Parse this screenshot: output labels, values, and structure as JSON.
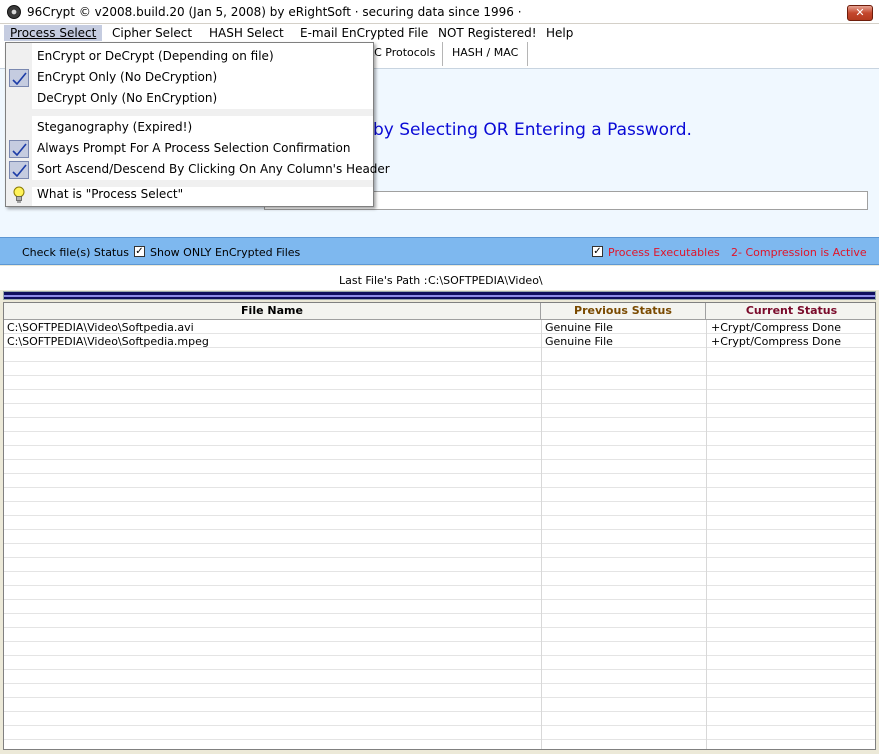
{
  "window": {
    "title": "96Crypt © v2008.build.20 (Jan 5, 2008) by eRightSoft ·   securing data since 1996   ·",
    "close_label": "✕"
  },
  "menu": {
    "process_select": "Process Select",
    "cipher_select": "Cipher Select",
    "hash_select": "HASH Select",
    "email_file": "E-mail EnCrypted File",
    "not_registered": "NOT Registered!",
    "help": "Help"
  },
  "tabs": {
    "crc": "RC Protocols",
    "hash_mac": "HASH / MAC"
  },
  "banner": {
    "text": "by Selecting OR Entering a Password."
  },
  "status_bar": {
    "check_status": "Check file(s) Status",
    "show_only_label": "Show ONLY EnCrypted Files",
    "process_exec_label": "Process Executables",
    "compression_label": "2- Compression is Active",
    "check_glyph": "✓",
    "accent_red": "#e0142a"
  },
  "path": {
    "label": "Last File's Path :",
    "value": "C:\\SOFTPEDIA\\Video\\"
  },
  "grid": {
    "headers": {
      "file_name": "File Name",
      "previous_status": "Previous Status",
      "current_status": "Current Status"
    },
    "header_colors": {
      "previous": "#7a4a00",
      "current": "#7a0a2a"
    },
    "rows": [
      {
        "file": "C:\\SOFTPEDIA\\Video\\Softpedia.avi",
        "previous": "Genuine File",
        "current": "+Crypt/Compress Done"
      },
      {
        "file": "C:\\SOFTPEDIA\\Video\\Softpedia.mpeg",
        "previous": "Genuine File",
        "current": "+Crypt/Compress Done"
      }
    ]
  },
  "dropdown": {
    "items": [
      {
        "label": "EnCrypt or DeCrypt (Depending on file)",
        "checked": false,
        "icon": ""
      },
      {
        "label": "EnCrypt Only (No DeCryption)",
        "checked": true,
        "icon": "check-icon"
      },
      {
        "label": "DeCrypt Only (No EnCryption)",
        "checked": false,
        "icon": ""
      },
      {
        "label": "Steganography (Expired!)",
        "checked": false,
        "icon": ""
      },
      {
        "label": "Always Prompt For A Process Selection Confirmation",
        "checked": true,
        "icon": "check-icon"
      },
      {
        "label": "Sort Ascend/Descend By Clicking On Any Column's Header",
        "checked": true,
        "icon": "check-icon"
      },
      {
        "label": "What is \"Process Select\"",
        "checked": false,
        "icon": "lightbulb-icon"
      }
    ]
  }
}
